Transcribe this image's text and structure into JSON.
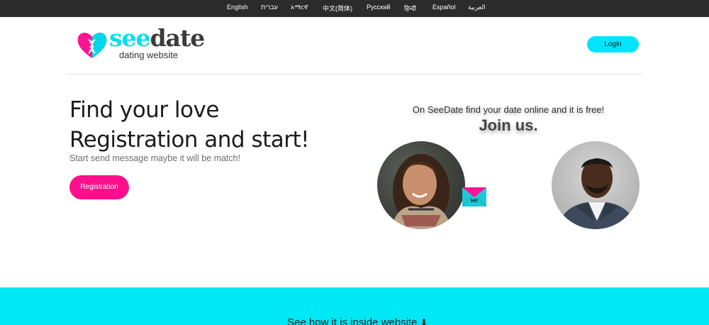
{
  "languages": [
    {
      "label": "English"
    },
    {
      "label": "עברית"
    },
    {
      "label": "አማርኛ"
    },
    {
      "label": "中文(简体)"
    },
    {
      "label": "Русский"
    },
    {
      "label": "हिन्दी"
    },
    {
      "label": "Español"
    },
    {
      "label": "العربية"
    }
  ],
  "logo": {
    "word_part1": "see",
    "word_part2": "date",
    "subtitle": "dating website",
    "icon": "heart-dna-icon",
    "colors": {
      "pink": "#ff1493",
      "cyan": "#00e1f0",
      "dark": "#3b3b3b"
    }
  },
  "header": {
    "login_label": "Login"
  },
  "hero": {
    "title_line1": "Find your love",
    "title_line2": "Registration and start!",
    "subtitle": "Start send message maybe it will be match!",
    "register_label": "Registration"
  },
  "promo": {
    "tagline": "On SeeDate find your date online and it is free!",
    "join": "Join us.",
    "envelope_text": "HI!",
    "envelope_icon": "envelope-icon"
  },
  "footer": {
    "text": "See how it is inside website",
    "arrow_icon": "arrow-down-icon"
  },
  "colors": {
    "accent_pink": "#ff0f8c",
    "accent_cyan": "#00e5ff",
    "topbar": "#2b2b2b"
  }
}
